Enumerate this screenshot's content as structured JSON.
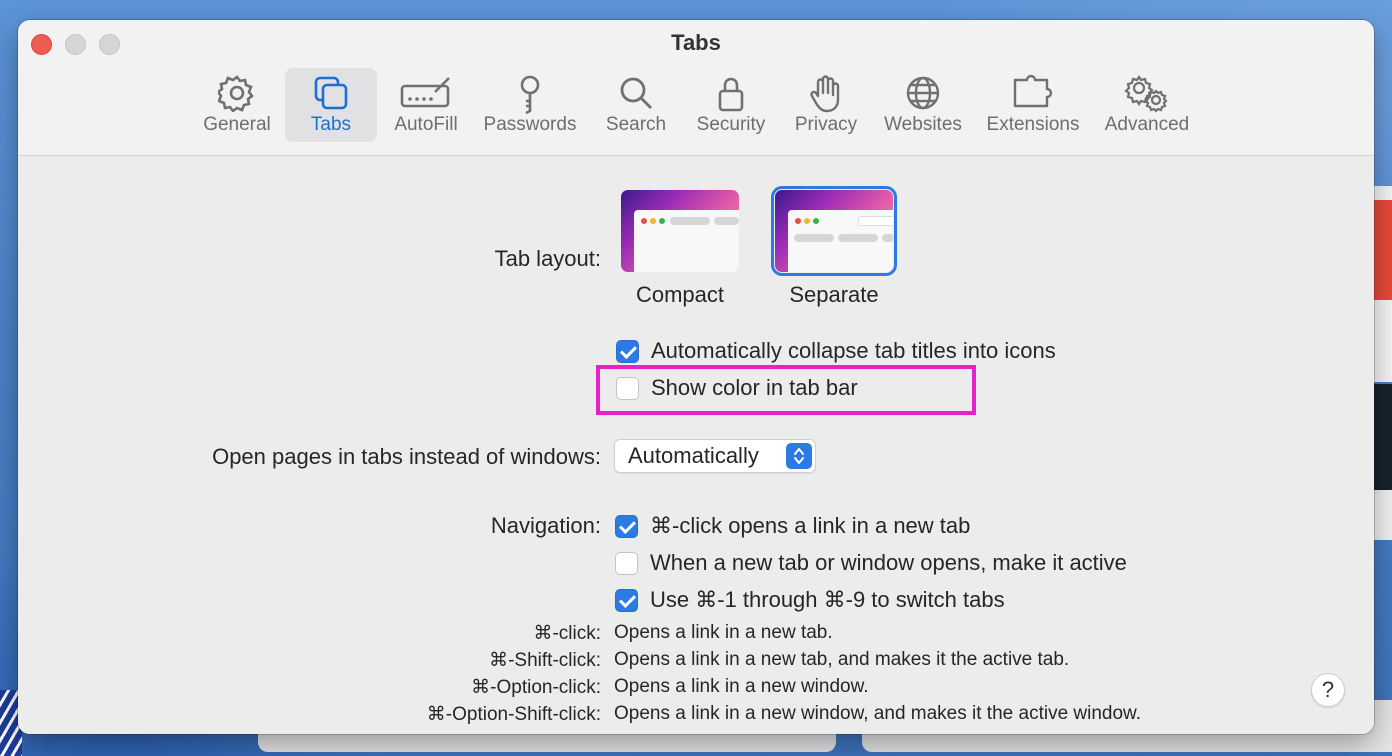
{
  "window": {
    "title": "Tabs"
  },
  "toolbar": {
    "items": [
      {
        "label": "General",
        "icon": "gear-icon",
        "active": false
      },
      {
        "label": "Tabs",
        "icon": "tabs-icon",
        "active": true
      },
      {
        "label": "AutoFill",
        "icon": "autofill-icon",
        "active": false
      },
      {
        "label": "Passwords",
        "icon": "key-icon",
        "active": false
      },
      {
        "label": "Search",
        "icon": "search-icon",
        "active": false
      },
      {
        "label": "Security",
        "icon": "lock-icon",
        "active": false
      },
      {
        "label": "Privacy",
        "icon": "hand-icon",
        "active": false
      },
      {
        "label": "Websites",
        "icon": "globe-icon",
        "active": false
      },
      {
        "label": "Extensions",
        "icon": "puzzle-icon",
        "active": false
      },
      {
        "label": "Advanced",
        "icon": "gears-icon",
        "active": false
      }
    ]
  },
  "tab_layout": {
    "label": "Tab layout:",
    "options": [
      {
        "label": "Compact",
        "selected": false
      },
      {
        "label": "Separate",
        "selected": true
      }
    ],
    "checkboxes": [
      {
        "label": "Automatically collapse tab titles into icons",
        "checked": true
      },
      {
        "label": "Show color in tab bar",
        "checked": false
      }
    ]
  },
  "open_pages": {
    "label": "Open pages in tabs instead of windows:",
    "value": "Automatically"
  },
  "navigation": {
    "label": "Navigation:",
    "checkboxes": [
      {
        "label": "⌘-click opens a link in a new tab",
        "checked": true
      },
      {
        "label": "When a new tab or window opens, make it active",
        "checked": false
      },
      {
        "label": "Use ⌘-1 through ⌘-9 to switch tabs",
        "checked": true
      }
    ]
  },
  "shortcuts": [
    {
      "key": "⌘-click:",
      "desc": "Opens a link in a new tab."
    },
    {
      "key": "⌘-Shift-click:",
      "desc": "Opens a link in a new tab, and makes it the active tab."
    },
    {
      "key": "⌘-Option-click:",
      "desc": "Opens a link in a new window."
    },
    {
      "key": "⌘-Option-Shift-click:",
      "desc": "Opens a link in a new window, and makes it the active window."
    }
  ],
  "help": {
    "label": "?"
  },
  "colors": {
    "accent": "#2c7be5",
    "highlight": "#e521c9",
    "close_button": "#ee5b55"
  }
}
